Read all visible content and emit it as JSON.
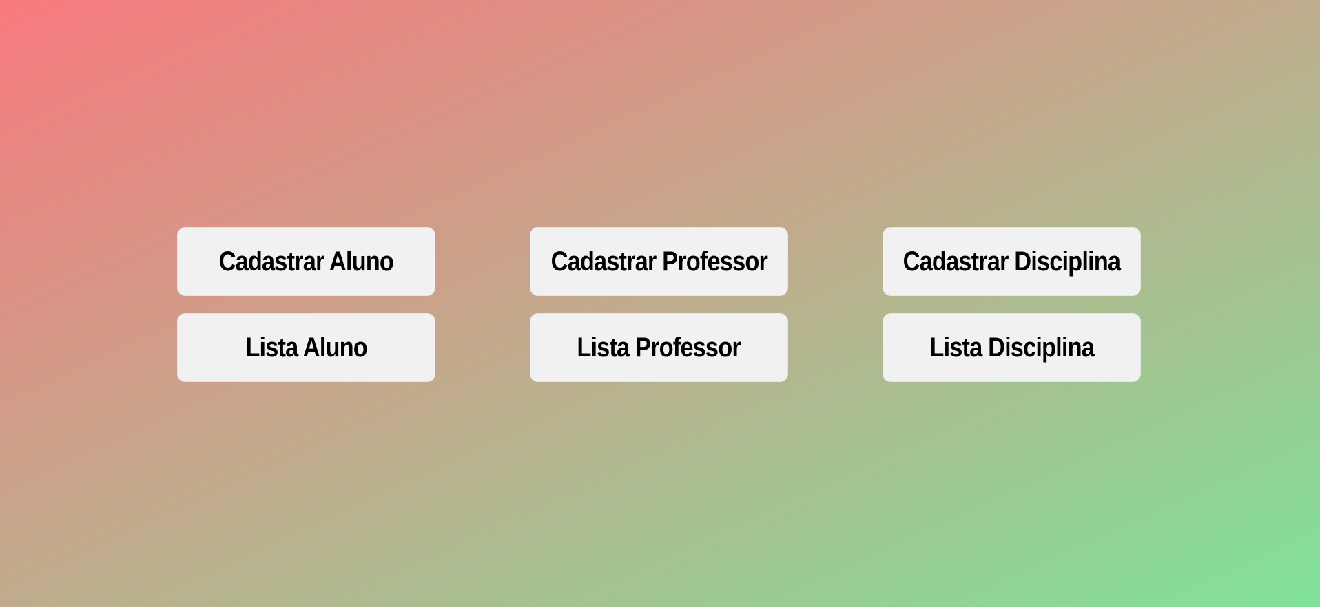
{
  "menu": {
    "buttons": [
      {
        "label": "Cadastrar Aluno"
      },
      {
        "label": "Cadastrar Professor"
      },
      {
        "label": "Cadastrar Disciplina"
      },
      {
        "label": "Lista Aluno"
      },
      {
        "label": "Lista Professor"
      },
      {
        "label": "Lista Disciplina"
      }
    ]
  },
  "colors": {
    "gradient_start": "#f87a7e",
    "gradient_end": "#80e299",
    "button_bg": "#f1f1f1",
    "button_text": "#000000"
  }
}
